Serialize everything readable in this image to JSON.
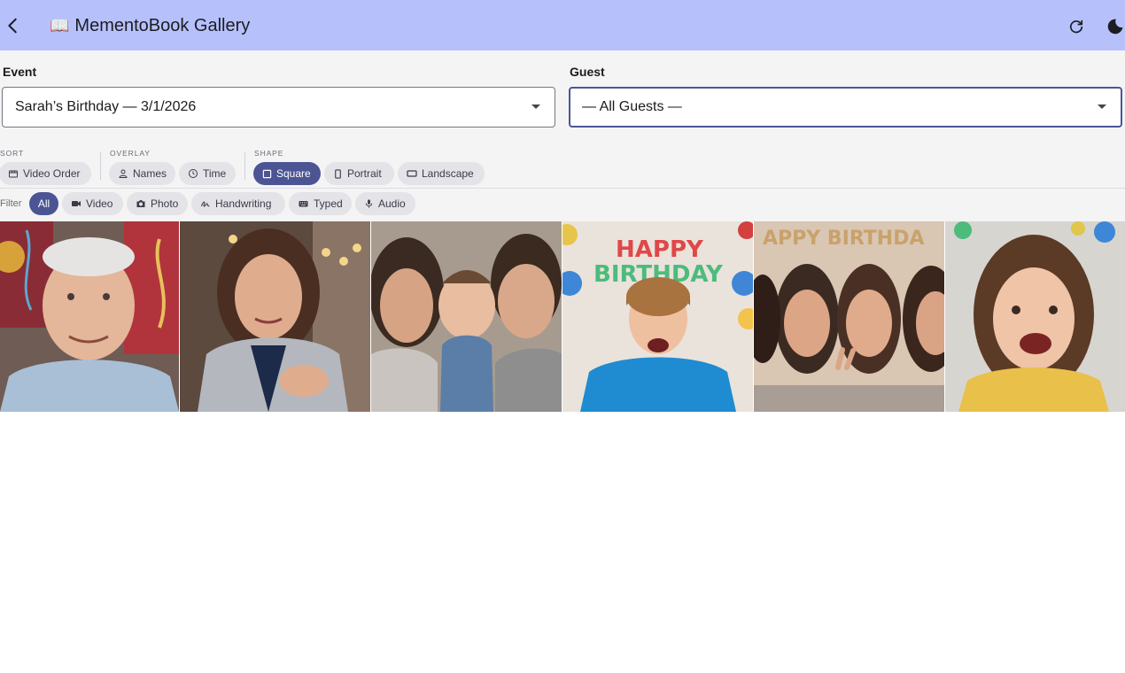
{
  "app": {
    "title": "MementoBook Gallery",
    "title_icon": "open-book-emoji"
  },
  "appbar": {
    "back_icon": "chevron-left-icon",
    "refresh_icon": "refresh-icon",
    "theme_icon": "dark-mode-moon-icon",
    "bg_color": "#b6c1fb"
  },
  "fields": {
    "event": {
      "label": "Event",
      "value": "Sarah’s Birthday — 3/1/2026"
    },
    "guest": {
      "label": "Guest",
      "value": "— All Guests —"
    }
  },
  "groups": {
    "sort": "SORT",
    "overlay": "OVERLAY",
    "shape": "SHAPE"
  },
  "sort": {
    "label": "Video Order",
    "icon": "clapperboard-icon"
  },
  "overlay": [
    {
      "label": "Names",
      "icon": "person-icon"
    },
    {
      "label": "Time",
      "icon": "clock-icon"
    }
  ],
  "shape": [
    {
      "label": "Square",
      "icon": "square-icon",
      "selected": true
    },
    {
      "label": "Portrait",
      "icon": "portrait-icon",
      "selected": false
    },
    {
      "label": "Landscape",
      "icon": "landscape-icon",
      "selected": false
    }
  ],
  "filter": {
    "label": "Filter",
    "chips": [
      {
        "label": "All",
        "selected": true
      },
      {
        "label": "Video",
        "icon": "videocam-icon"
      },
      {
        "label": "Photo",
        "icon": "camera-icon"
      },
      {
        "label": "Handwriting",
        "icon": "handwriting-icon"
      },
      {
        "label": "Typed",
        "icon": "keyboard-icon"
      },
      {
        "label": "Audio",
        "icon": "microphone-icon"
      }
    ]
  },
  "gallery": [
    {
      "subject": "elderly-man-selfie"
    },
    {
      "subject": "woman-selfie-hand-on-chest"
    },
    {
      "subject": "family-with-baby"
    },
    {
      "subject": "boy-under-happy-birthday-banner"
    },
    {
      "subject": "three-women-with-happy-birthday-banner"
    },
    {
      "subject": "girl-smiling"
    }
  ],
  "colors": {
    "accent": "#4b5594",
    "chip": "#e3e3e8",
    "surface": "#f4f4f5"
  }
}
